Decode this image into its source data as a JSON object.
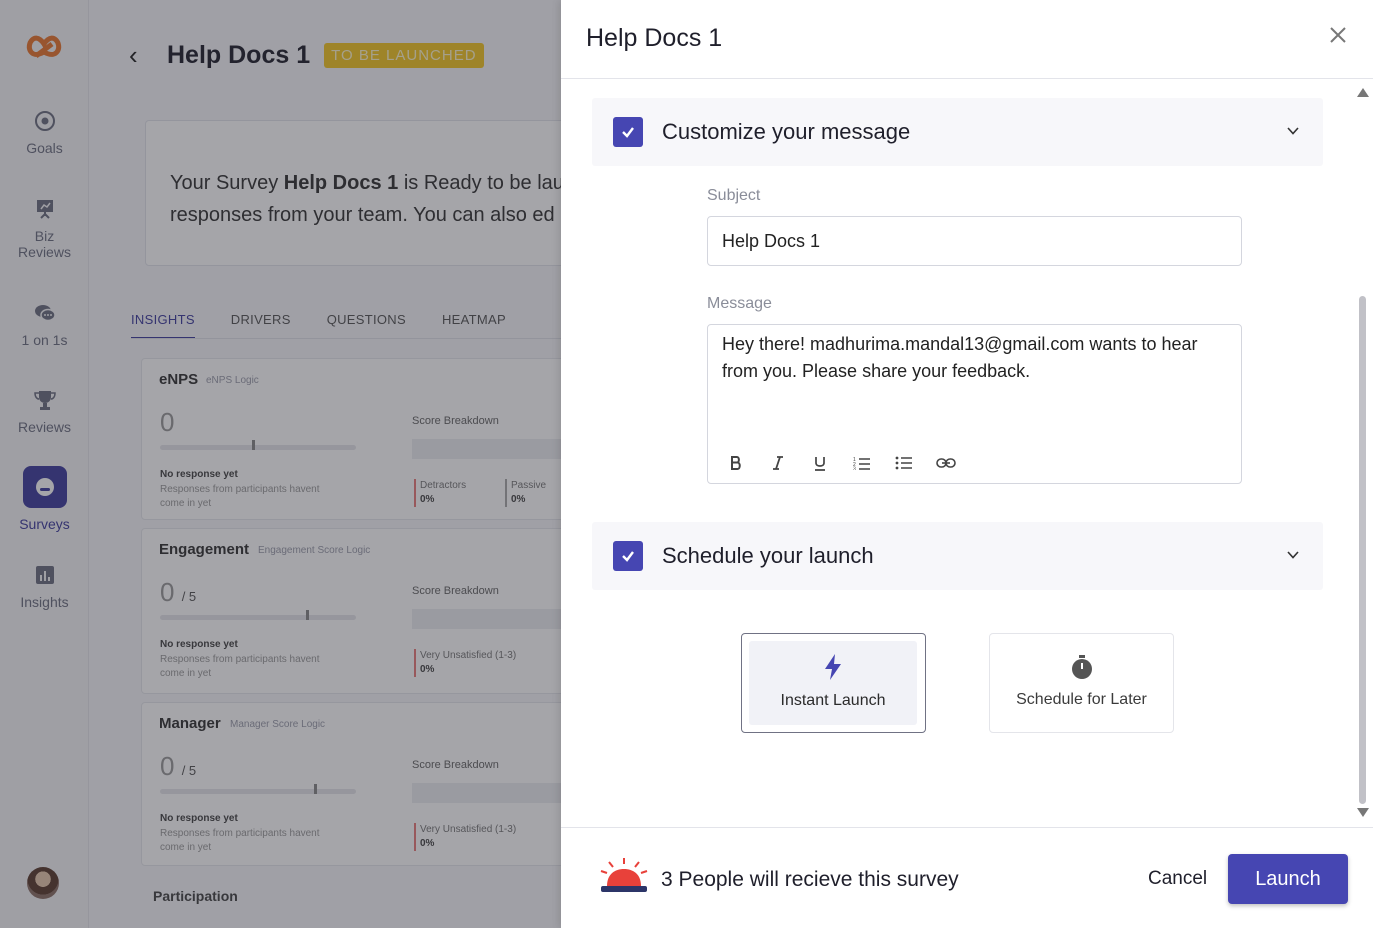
{
  "sidebar": {
    "items": [
      {
        "label": "Goals",
        "icon": "target-icon"
      },
      {
        "label": "Biz Reviews",
        "icon": "presentation-icon"
      },
      {
        "label": "1 on 1s",
        "icon": "chat-bubbles-icon"
      },
      {
        "label": "Reviews",
        "icon": "trophy-icon"
      },
      {
        "label": "Surveys",
        "icon": "survey-icon",
        "active": true
      },
      {
        "label": "Insights",
        "icon": "bar-chart-icon"
      }
    ]
  },
  "page": {
    "title": "Help Docs 1",
    "status": "TO BE LAUNCHED",
    "ready_prefix": "Your Survey ",
    "ready_name": "Help Docs 1",
    "ready_suffix": " is Ready to be lau",
    "ready_line2": "responses from your team. You can also ed"
  },
  "tabs": [
    "INSIGHTS",
    "DRIVERS",
    "QUESTIONS",
    "HEATMAP"
  ],
  "cards": [
    {
      "title": "eNPS",
      "sub": "eNPS Logic",
      "score": "0",
      "unit": "",
      "breakdown": "Score Breakdown",
      "legend_a": "Detractors",
      "legend_a_val": "0%",
      "legend_b": "Passive",
      "legend_b_val": "0%",
      "no_response": "No response yet",
      "no_response_sub": "Responses from participants havent come in yet"
    },
    {
      "title": "Engagement",
      "sub": "Engagement Score Logic",
      "score": "0",
      "unit": "/ 5",
      "breakdown": "Score Breakdown",
      "legend_a": "Very Unsatisfied (1-3)",
      "legend_a_val": "0%",
      "legend_b": "",
      "legend_b_val": "",
      "no_response": "No response yet",
      "no_response_sub": "Responses from participants havent come in yet"
    },
    {
      "title": "Manager",
      "sub": "Manager Score Logic",
      "score": "0",
      "unit": "/ 5",
      "breakdown": "Score Breakdown",
      "legend_a": "Very Unsatisfied (1-3)",
      "legend_a_val": "0%",
      "legend_b": "",
      "legend_b_val": "",
      "no_response": "No response yet",
      "no_response_sub": "Responses from participants havent come in yet"
    }
  ],
  "participation_label": "Participation",
  "drawer": {
    "title": "Help Docs 1",
    "customize": {
      "title": "Customize your message",
      "subject_label": "Subject",
      "subject_value": "Help Docs 1",
      "message_label": "Message",
      "message_value": "Hey there! madhurima.mandal13@gmail.com wants to hear from you. Please share your feedback."
    },
    "schedule": {
      "title": "Schedule your launch",
      "instant_label": "Instant Launch",
      "later_label": "Schedule for Later"
    },
    "footer": {
      "recipients_text": "3 People will recieve this survey",
      "cancel_label": "Cancel",
      "launch_label": "Launch"
    }
  },
  "colors": {
    "accent": "#4646b2",
    "status_tag": "#f3c623",
    "siren_red": "#e8413a",
    "siren_base": "#2c3568"
  }
}
